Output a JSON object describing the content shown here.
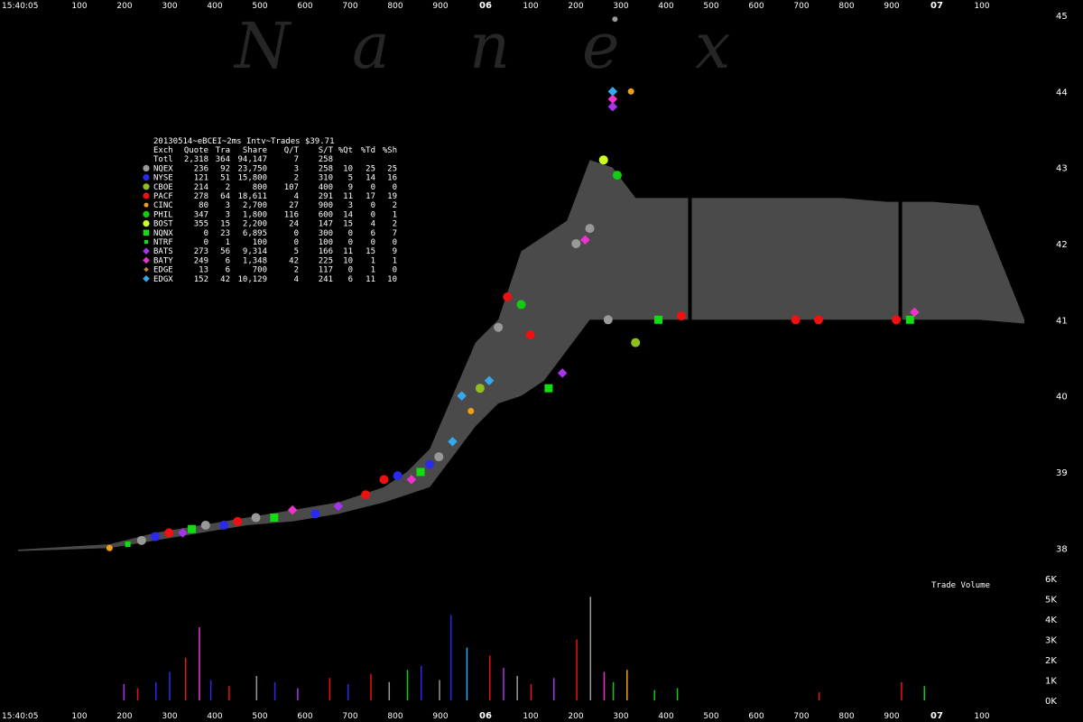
{
  "watermark": [
    "N",
    "a",
    "n",
    "e",
    "x"
  ],
  "time_start_label": "15:40:05",
  "top_axis_labels": [
    "100",
    "200",
    "300",
    "400",
    "500",
    "600",
    "700",
    "800",
    "900",
    "06",
    "100",
    "200",
    "300",
    "400",
    "500",
    "600",
    "700",
    "800",
    "900",
    "07",
    "100"
  ],
  "bottom_axis_labels": [
    "100",
    "200",
    "300",
    "400",
    "500",
    "600",
    "700",
    "800",
    "900",
    "06",
    "100",
    "200",
    "300",
    "400",
    "500",
    "600",
    "700",
    "800",
    "900",
    "07",
    "100"
  ],
  "volume_title": "Trade Volume",
  "legend": {
    "title": "20130514~eBCEI~2ms Intv~Trades $39.71",
    "headers": [
      "Exch",
      "Quote",
      "Tra",
      "Share",
      "Q/T",
      "S/T",
      "%Qt",
      "%Td",
      "%Sh"
    ],
    "total_row": [
      "Totl",
      "2,318",
      "364",
      "94,147",
      "7",
      "258",
      "",
      "",
      ""
    ],
    "rows": [
      {
        "marker": "circle",
        "color": "#999999",
        "cells": [
          "NQEX",
          "236",
          "92",
          "23,750",
          "3",
          "258",
          "10",
          "25",
          "25"
        ]
      },
      {
        "marker": "circle",
        "color": "#2a2aee",
        "cells": [
          "NYSE",
          "121",
          "51",
          "15,800",
          "2",
          "310",
          "5",
          "14",
          "16"
        ]
      },
      {
        "marker": "circle",
        "color": "#8fbf1f",
        "cells": [
          "CBOE",
          "214",
          "2",
          "800",
          "107",
          "400",
          "9",
          "0",
          "0"
        ]
      },
      {
        "marker": "circle",
        "color": "#ee1111",
        "cells": [
          "PACF",
          "278",
          "64",
          "18,611",
          "4",
          "291",
          "11",
          "17",
          "19"
        ]
      },
      {
        "marker": "circle-small",
        "color": "#f0a010",
        "cells": [
          "CINC",
          "80",
          "3",
          "2,700",
          "27",
          "900",
          "3",
          "0",
          "2"
        ]
      },
      {
        "marker": "circle",
        "color": "#11cc11",
        "cells": [
          "PHIL",
          "347",
          "3",
          "1,800",
          "116",
          "600",
          "14",
          "0",
          "1"
        ]
      },
      {
        "marker": "circle",
        "color": "#ccff22",
        "cells": [
          "BOST",
          "355",
          "15",
          "2,200",
          "24",
          "147",
          "15",
          "4",
          "2"
        ]
      },
      {
        "marker": "square",
        "color": "#11dd11",
        "cells": [
          "NQNX",
          "0",
          "23",
          "6,895",
          "0",
          "300",
          "0",
          "6",
          "7"
        ]
      },
      {
        "marker": "square-small",
        "color": "#11dd11",
        "cells": [
          "NTRF",
          "0",
          "1",
          "100",
          "0",
          "100",
          "0",
          "0",
          "0"
        ]
      },
      {
        "marker": "diamond",
        "color": "#aa33ee",
        "cells": [
          "BATS",
          "273",
          "56",
          "9,314",
          "5",
          "166",
          "11",
          "15",
          "9"
        ]
      },
      {
        "marker": "diamond",
        "color": "#ee33cc",
        "cells": [
          "BATY",
          "249",
          "6",
          "1,348",
          "42",
          "225",
          "10",
          "1",
          "1"
        ]
      },
      {
        "marker": "diamond-small",
        "color": "#cc8833",
        "cells": [
          "EDGE",
          "13",
          "6",
          "700",
          "2",
          "117",
          "0",
          "1",
          "0"
        ]
      },
      {
        "marker": "diamond",
        "color": "#33aaee",
        "cells": [
          "EDGX",
          "152",
          "42",
          "10,129",
          "4",
          "241",
          "6",
          "11",
          "10"
        ]
      }
    ]
  },
  "chart_data": [
    {
      "type": "scatter",
      "title": "20130514~eBCEI~2ms Intv~Trades $39.71",
      "description_note": "",
      "x_unit": "milliseconds after 15:40:05",
      "y_ticks": [
        38,
        39,
        40,
        41,
        42,
        43,
        44,
        45
      ],
      "ylim": [
        37.6,
        45
      ],
      "xlim": [
        0,
        2200
      ],
      "band": {
        "x": [
          0,
          200,
          300,
          400,
          500,
          600,
          700,
          800,
          850,
          900,
          950,
          1000,
          1050,
          1100,
          1150,
          1200,
          1250,
          1300,
          1350,
          1400,
          1500,
          1600,
          1700,
          1800,
          1900,
          2000,
          2100,
          2200
        ],
        "high": [
          37.98,
          38.05,
          38.2,
          38.3,
          38.4,
          38.5,
          38.6,
          38.8,
          39.0,
          39.3,
          40.0,
          40.7,
          41.0,
          41.9,
          42.1,
          42.3,
          43.1,
          43.0,
          42.6,
          42.6,
          42.6,
          42.6,
          42.6,
          42.6,
          42.55,
          42.55,
          42.5,
          41.0
        ],
        "low": [
          37.96,
          38.0,
          38.1,
          38.2,
          38.3,
          38.35,
          38.45,
          38.6,
          38.7,
          38.8,
          39.2,
          39.6,
          39.9,
          40.0,
          40.2,
          40.6,
          41.0,
          41.0,
          41.0,
          41.0,
          41.0,
          41.0,
          41.0,
          41.0,
          41.0,
          41.0,
          41.0,
          40.95
        ]
      },
      "trades": [
        {
          "x": 200,
          "y": 38.0,
          "exch": "CINC"
        },
        {
          "x": 240,
          "y": 38.05,
          "exch": "NTRF"
        },
        {
          "x": 270,
          "y": 38.1,
          "exch": "NQEX"
        },
        {
          "x": 300,
          "y": 38.15,
          "exch": "NYSE"
        },
        {
          "x": 330,
          "y": 38.2,
          "exch": "PACF"
        },
        {
          "x": 360,
          "y": 38.2,
          "exch": "BATS"
        },
        {
          "x": 380,
          "y": 38.25,
          "exch": "NQNX"
        },
        {
          "x": 410,
          "y": 38.3,
          "exch": "NQEX"
        },
        {
          "x": 450,
          "y": 38.3,
          "exch": "NYSE"
        },
        {
          "x": 480,
          "y": 38.35,
          "exch": "PACF"
        },
        {
          "x": 520,
          "y": 38.4,
          "exch": "NQEX"
        },
        {
          "x": 560,
          "y": 38.4,
          "exch": "NQNX"
        },
        {
          "x": 600,
          "y": 38.5,
          "exch": "BATY"
        },
        {
          "x": 650,
          "y": 38.45,
          "exch": "NYSE"
        },
        {
          "x": 700,
          "y": 38.55,
          "exch": "BATS"
        },
        {
          "x": 760,
          "y": 38.7,
          "exch": "PACF"
        },
        {
          "x": 800,
          "y": 38.9,
          "exch": "PACF"
        },
        {
          "x": 830,
          "y": 38.95,
          "exch": "NYSE"
        },
        {
          "x": 860,
          "y": 38.9,
          "exch": "BATY"
        },
        {
          "x": 880,
          "y": 39.0,
          "exch": "NQNX"
        },
        {
          "x": 900,
          "y": 39.1,
          "exch": "NYSE"
        },
        {
          "x": 920,
          "y": 39.2,
          "exch": "NQEX"
        },
        {
          "x": 950,
          "y": 39.4,
          "exch": "EDGX"
        },
        {
          "x": 970,
          "y": 40.0,
          "exch": "EDGX"
        },
        {
          "x": 990,
          "y": 39.8,
          "exch": "CINC"
        },
        {
          "x": 1010,
          "y": 40.1,
          "exch": "CBOE"
        },
        {
          "x": 1030,
          "y": 40.2,
          "exch": "EDGX"
        },
        {
          "x": 1050,
          "y": 40.9,
          "exch": "NQEX"
        },
        {
          "x": 1070,
          "y": 41.3,
          "exch": "PACF"
        },
        {
          "x": 1100,
          "y": 41.2,
          "exch": "PHIL"
        },
        {
          "x": 1120,
          "y": 40.8,
          "exch": "PACF"
        },
        {
          "x": 1160,
          "y": 40.1,
          "exch": "NQNX"
        },
        {
          "x": 1190,
          "y": 40.3,
          "exch": "BATS"
        },
        {
          "x": 1220,
          "y": 42.0,
          "exch": "NQEX"
        },
        {
          "x": 1240,
          "y": 42.05,
          "exch": "BATY"
        },
        {
          "x": 1250,
          "y": 42.2,
          "exch": "NQEX"
        },
        {
          "x": 1280,
          "y": 43.1,
          "exch": "BOST"
        },
        {
          "x": 1290,
          "y": 41.0,
          "exch": "NQEX"
        },
        {
          "x": 1300,
          "y": 44.0,
          "exch": "EDGX"
        },
        {
          "x": 1300,
          "y": 43.9,
          "exch": "BATY"
        },
        {
          "x": 1300,
          "y": 43.8,
          "exch": "BATS"
        },
        {
          "x": 1310,
          "y": 42.9,
          "exch": "PHIL"
        },
        {
          "x": 1340,
          "y": 44.0,
          "exch": "CINC"
        },
        {
          "x": 1350,
          "y": 40.7,
          "exch": "CBOE"
        },
        {
          "x": 1400,
          "y": 41.0,
          "exch": "NQNX"
        },
        {
          "x": 1450,
          "y": 41.05,
          "exch": "PACF"
        },
        {
          "x": 1700,
          "y": 41.0,
          "exch": "PACF"
        },
        {
          "x": 1750,
          "y": 41.0,
          "exch": "PACF"
        },
        {
          "x": 1920,
          "y": 41.0,
          "exch": "PACF"
        },
        {
          "x": 1950,
          "y": 41.0,
          "exch": "NQNX"
        },
        {
          "x": 1960,
          "y": 41.1,
          "exch": "BATY"
        }
      ]
    },
    {
      "type": "bar",
      "title": "Trade Volume",
      "y_ticks_labels": [
        "0K",
        "1K",
        "2K",
        "3K",
        "4K",
        "5K",
        "6K"
      ],
      "ylim": [
        0,
        6000
      ],
      "bars": [
        {
          "x": 230,
          "v": 800,
          "exch": "BATS"
        },
        {
          "x": 260,
          "v": 600,
          "exch": "PACF"
        },
        {
          "x": 300,
          "v": 900,
          "exch": "NYSE"
        },
        {
          "x": 330,
          "v": 1400,
          "exch": "NYSE"
        },
        {
          "x": 365,
          "v": 2100,
          "exch": "PACF"
        },
        {
          "x": 395,
          "v": 3600,
          "exch": "BATY"
        },
        {
          "x": 420,
          "v": 1000,
          "exch": "NYSE"
        },
        {
          "x": 460,
          "v": 700,
          "exch": "PACF"
        },
        {
          "x": 520,
          "v": 1200,
          "exch": "NQEX"
        },
        {
          "x": 560,
          "v": 900,
          "exch": "NYSE"
        },
        {
          "x": 610,
          "v": 600,
          "exch": "BATS"
        },
        {
          "x": 680,
          "v": 1100,
          "exch": "PACF"
        },
        {
          "x": 720,
          "v": 800,
          "exch": "NYSE"
        },
        {
          "x": 770,
          "v": 1300,
          "exch": "PACF"
        },
        {
          "x": 810,
          "v": 900,
          "exch": "NQEX"
        },
        {
          "x": 850,
          "v": 1500,
          "exch": "PHIL"
        },
        {
          "x": 880,
          "v": 1700,
          "exch": "NYSE"
        },
        {
          "x": 920,
          "v": 1000,
          "exch": "NQEX"
        },
        {
          "x": 945,
          "v": 4200,
          "exch": "NYSE"
        },
        {
          "x": 980,
          "v": 2600,
          "exch": "EDGX"
        },
        {
          "x": 1030,
          "v": 2200,
          "exch": "PACF"
        },
        {
          "x": 1060,
          "v": 1600,
          "exch": "BATS"
        },
        {
          "x": 1090,
          "v": 1200,
          "exch": "NQEX"
        },
        {
          "x": 1120,
          "v": 800,
          "exch": "PACF"
        },
        {
          "x": 1170,
          "v": 1100,
          "exch": "BATS"
        },
        {
          "x": 1220,
          "v": 3000,
          "exch": "PACF"
        },
        {
          "x": 1250,
          "v": 5100,
          "exch": "NQEX"
        },
        {
          "x": 1280,
          "v": 1400,
          "exch": "BATY"
        },
        {
          "x": 1300,
          "v": 900,
          "exch": "PHIL"
        },
        {
          "x": 1330,
          "v": 1500,
          "exch": "CINC"
        },
        {
          "x": 1390,
          "v": 500,
          "exch": "PHIL"
        },
        {
          "x": 1440,
          "v": 600,
          "exch": "PHIL"
        },
        {
          "x": 1750,
          "v": 400,
          "exch": "PACF"
        },
        {
          "x": 1930,
          "v": 900,
          "exch": "PACF"
        },
        {
          "x": 1980,
          "v": 700,
          "exch": "PHIL"
        }
      ]
    }
  ]
}
